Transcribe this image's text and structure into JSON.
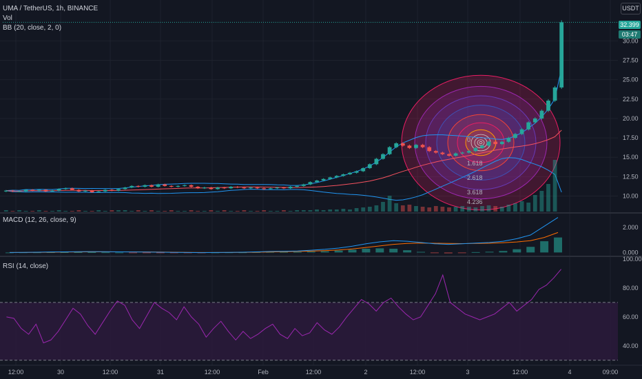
{
  "header": {
    "symbol_line": "UMA / TetherUS, 1h, BINANCE",
    "vol_label": "Vol",
    "bb_label": "BB (20, close, 2, 0)",
    "currency_badge": "USDT",
    "last_price": "32.399",
    "countdown": "03:47"
  },
  "colors": {
    "background": "#131722",
    "up": "#26a69a",
    "down": "#ef5350",
    "grid": "#1e222d",
    "bb_basis": "#f7525f",
    "bb_band": "#2196f3",
    "macd_line": "#2196f3",
    "signal_line": "#ff6d00",
    "rsi_line": "#9c27b0",
    "rsi_band": "#2a1a3a"
  },
  "macd_panel": {
    "label": "MACD (12, 26, close, 9)",
    "ticks": [
      "2.000",
      "0.000"
    ]
  },
  "rsi_panel": {
    "label": "RSI (14, close)",
    "ticks": [
      "100.00",
      "80.00",
      "60.00",
      "40.00"
    ]
  },
  "fib_labels": [
    "0",
    "1.618",
    "2.618",
    "3.618",
    "4.236"
  ],
  "chart_data": [
    {
      "type": "candlestick",
      "title": "UMA / TetherUS, 1h, BINANCE",
      "y_ticks": [
        "30.00",
        "27.50",
        "25.00",
        "22.50",
        "20.00",
        "17.50",
        "15.00",
        "12.50",
        "10.00"
      ],
      "ylim": [
        8,
        33.5
      ],
      "x_ticks": [
        "12:00",
        "30",
        "12:00",
        "31",
        "12:00",
        "Feb",
        "12:00",
        "2",
        "12:00",
        "3",
        "12:00",
        "4",
        "09:00"
      ],
      "close_series": [
        10.7,
        10.6,
        10.6,
        10.8,
        10.7,
        10.8,
        10.6,
        10.7,
        10.9,
        11,
        10.8,
        10.6,
        10.7,
        10.5,
        10.6,
        10.8,
        10.7,
        10.9,
        11.1,
        11.3,
        11.2,
        11.4,
        11.2,
        11.5,
        11.3,
        11.2,
        11.3,
        11.4,
        11.2,
        11,
        11.1,
        10.9,
        11.1,
        11,
        11.2,
        11.1,
        11,
        11.1,
        11,
        10.9,
        11,
        11.1,
        11,
        11.2,
        11.3,
        11.5,
        11.8,
        12,
        12.2,
        12.4,
        12.6,
        12.8,
        13,
        13.2,
        13.6,
        14.1,
        14.8,
        15.4,
        16.3,
        16.8,
        16.5,
        16.2,
        16.6,
        16.3,
        15.8,
        15.6,
        15.4,
        15.2,
        15.5,
        15.6,
        15.8,
        16.2,
        16.5,
        17,
        16.7,
        17,
        17.5,
        18,
        18.6,
        19.5,
        20,
        21,
        22.3,
        24,
        32.4
      ],
      "volume_series": [
        2,
        1,
        2,
        1,
        1,
        2,
        1,
        1,
        2,
        1,
        1,
        2,
        1,
        1,
        2,
        1,
        2,
        2,
        2,
        1,
        2,
        1,
        2,
        1,
        1,
        2,
        1,
        1,
        2,
        1,
        1,
        2,
        1,
        2,
        1,
        1,
        2,
        1,
        1,
        2,
        1,
        1,
        2,
        1,
        2,
        2,
        2,
        3,
        2,
        3,
        3,
        4,
        3,
        5,
        6,
        7,
        9,
        14,
        23,
        12,
        9,
        10,
        8,
        7,
        6,
        8,
        7,
        6,
        7,
        8,
        7,
        6,
        8,
        9,
        8,
        7,
        10,
        12,
        15,
        13,
        24,
        30,
        40,
        75
      ],
      "bollinger": {
        "period": 20,
        "stddev": 2
      }
    },
    {
      "type": "line",
      "title": "MACD (12, 26, close, 9)",
      "series": [
        {
          "name": "MACD",
          "values": [
            0,
            0.01,
            0.02,
            0.04,
            0.05,
            0.06,
            0.07,
            0.06,
            0.05,
            0.04,
            0.03,
            0.02,
            0.01,
            0,
            -0.01,
            0,
            0.01,
            0.02,
            0.05,
            0.08,
            0.1,
            0.12,
            0.18,
            0.25,
            0.35,
            0.5,
            0.7,
            0.85,
            0.95,
            0.9,
            0.8,
            0.7,
            0.65,
            0.7,
            0.75,
            0.8,
            0.9,
            1.1,
            1.4,
            2.1,
            2.8
          ]
        },
        {
          "name": "Signal",
          "values": [
            0,
            0,
            0.01,
            0.02,
            0.03,
            0.04,
            0.05,
            0.05,
            0.05,
            0.05,
            0.04,
            0.03,
            0.02,
            0.01,
            0,
            0,
            0,
            0.01,
            0.02,
            0.04,
            0.06,
            0.08,
            0.11,
            0.15,
            0.2,
            0.28,
            0.4,
            0.52,
            0.65,
            0.72,
            0.75,
            0.74,
            0.72,
            0.71,
            0.72,
            0.74,
            0.78,
            0.84,
            0.95,
            1.2,
            1.6
          ]
        }
      ],
      "ylim": [
        -0.2,
        3
      ]
    },
    {
      "type": "line",
      "title": "RSI (14, close)",
      "series": [
        {
          "name": "RSI",
          "values": [
            60,
            59,
            52,
            48,
            55,
            42,
            44,
            50,
            58,
            66,
            62,
            54,
            48,
            56,
            64,
            71,
            68,
            58,
            52,
            61,
            70,
            66,
            63,
            58,
            67,
            60,
            55,
            46,
            52,
            57,
            50,
            44,
            50,
            45,
            48,
            52,
            55,
            48,
            45,
            52,
            47,
            49,
            56,
            51,
            48,
            53,
            60,
            66,
            72,
            69,
            64,
            70,
            73,
            67,
            62,
            58,
            60,
            68,
            76,
            89,
            70,
            66,
            62,
            60,
            58,
            60,
            62,
            66,
            70,
            64,
            68,
            72,
            79,
            82,
            87,
            93
          ]
        }
      ],
      "ylim": [
        28,
        100
      ]
    }
  ]
}
